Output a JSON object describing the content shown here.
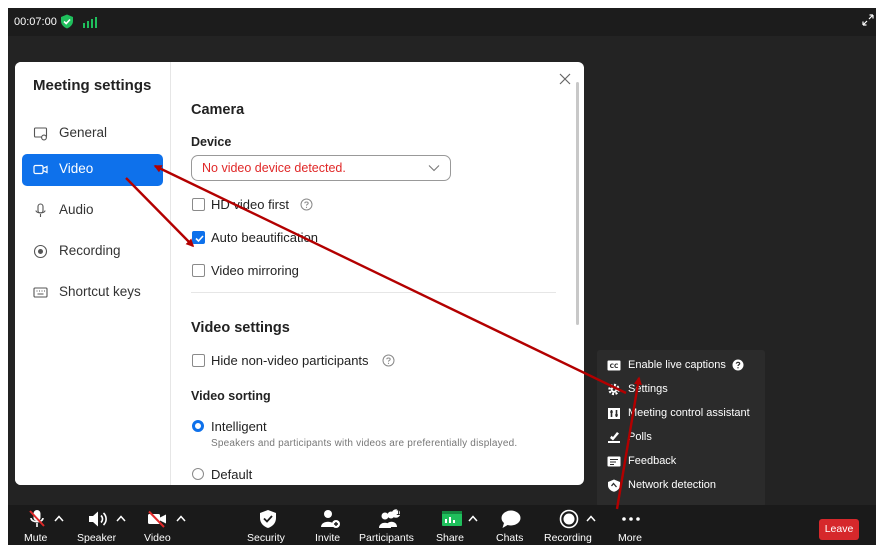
{
  "topbar": {
    "timer": "00:07:00"
  },
  "dialog": {
    "title": "Meeting settings",
    "sidebar": {
      "items": [
        {
          "label": "General",
          "icon": "general-icon"
        },
        {
          "label": "Video",
          "icon": "video-camera-icon",
          "active": true
        },
        {
          "label": "Audio",
          "icon": "microphone-icon"
        },
        {
          "label": "Recording",
          "icon": "record-icon"
        },
        {
          "label": "Shortcut keys",
          "icon": "keyboard-icon"
        }
      ]
    },
    "camera": {
      "heading": "Camera",
      "device_label": "Device",
      "device_value": "No video device detected.",
      "options": [
        {
          "label": "HD video first",
          "checked": false,
          "help": true
        },
        {
          "label": "Auto beautification",
          "checked": true
        },
        {
          "label": "Video mirroring",
          "checked": false
        }
      ]
    },
    "video_settings": {
      "heading": "Video settings",
      "hide_non_video": {
        "label": "Hide non-video participants",
        "checked": false,
        "help": true
      },
      "sorting_label": "Video sorting",
      "sorting_options": [
        {
          "label": "Intelligent",
          "description": "Speakers and participants with videos are preferentially displayed.",
          "selected": true
        },
        {
          "label": "Default",
          "selected": false
        }
      ]
    }
  },
  "more_menu": {
    "items": [
      {
        "label": "Enable live captions",
        "icon": "captions-icon"
      },
      {
        "label": "Settings",
        "icon": "gear-icon"
      },
      {
        "label": "Meeting control assistant",
        "icon": "assistant-icon"
      },
      {
        "label": "Polls",
        "icon": "polls-icon"
      },
      {
        "label": "Feedback",
        "icon": "feedback-icon"
      },
      {
        "label": "Network detection",
        "icon": "network-icon"
      }
    ]
  },
  "toolbar": {
    "mute": "Mute",
    "speaker": "Speaker",
    "video": "Video",
    "security": "Security",
    "invite": "Invite",
    "participants": "Participants",
    "participants_count": "1",
    "share": "Share",
    "chats": "Chats",
    "recording": "Recording",
    "more": "More",
    "leave": "Leave"
  },
  "colors": {
    "accent": "#0e71eb",
    "error_text": "#e02828",
    "leave": "#d6282b",
    "annotation_arrow": "#b30000",
    "secure_green": "#1fbf5c"
  }
}
